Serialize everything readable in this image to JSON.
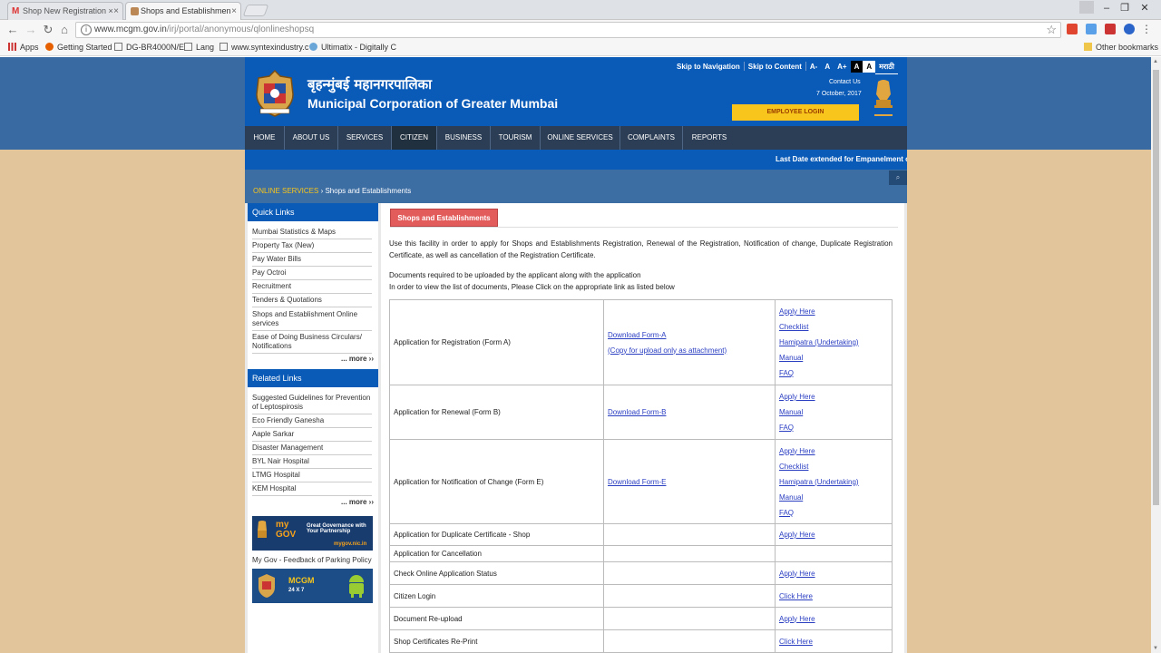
{
  "browser": {
    "tabs": [
      {
        "title": "Shop New Registration ×"
      },
      {
        "title": "Shops and Establishmen"
      }
    ],
    "url_host": "www.mcgm.gov.in",
    "url_path": "/irj/portal/anonymous/qlonlineshopsq",
    "bookmarks": [
      "Apps",
      "Getting Started",
      "DG-BR4000N/E",
      "Lang",
      "www.syntexindustry.c",
      "Ultimatix - Digitally C",
      "Other bookmarks"
    ]
  },
  "site": {
    "marathi_title": "बृहन्मुंबई महानगरपालिका",
    "title": "Municipal Corporation of Greater Mumbai",
    "topbar": [
      "Skip to Navigation",
      "Skip to Content",
      "A-",
      "A",
      "A+",
      "A",
      "A",
      "मराठी"
    ],
    "contact": "Contact Us",
    "date": "7 October, 2017",
    "employee_login": "EMPLOYEE LOGIN",
    "nav": [
      "HOME",
      "ABOUT US",
      "SERVICES",
      "CITIZEN",
      "BUSINESS",
      "TOURISM",
      "ONLINE SERVICES",
      "COMPLAINTS",
      "REPORTS"
    ],
    "ticker": "Last Date extended for Empanelment of A",
    "breadcrumb_parent": "ONLINE SERVICES",
    "breadcrumb_sep": "›",
    "breadcrumb_current": "Shops and Establishments"
  },
  "sidebar": {
    "quick_title": "Quick Links",
    "quick_links": [
      "Mumbai Statistics & Maps",
      "Property Tax (New)",
      "Pay Water Bills",
      "Pay Octroi",
      "Recruitment",
      "Tenders & Quotations",
      "Shops and Establishment Online services",
      "Ease of Doing Business Circulars/ Notifications"
    ],
    "more": "... more ››",
    "related_title": "Related Links",
    "related_links": [
      "Suggested Guidelines for Prevention of Leptospirosis",
      "Eco Friendly Ganesha",
      "Aaple Sarkar",
      "Disaster Management",
      "BYL Nair Hospital",
      "LTMG Hospital",
      "KEM Hospital"
    ],
    "mygov_banner": "Great Governance with Your Partnership",
    "mygov_url": "mygov.nic.in",
    "mygov_caption": "My Gov - Feedback of Parking Policy",
    "mcgm_app_title": "MCGM",
    "mcgm_app_sub": "24 X 7"
  },
  "content": {
    "heading": "Shops and Establishments",
    "intro": "Use this facility in order to apply for Shops and Establishments Registration, Renewal of the Registration, Notification of change, Duplicate Registration Certificate, as well as cancellation of the Registration Certificate.",
    "docs_line1": "Documents required to be uploaded by the applicant along with the application",
    "docs_line2": "In order to view the list of documents, Please Click on the appropriate link as listed below",
    "rows": [
      {
        "label": "Application for Registration (Form A)",
        "forms": [
          "Download Form-A",
          "(Copy for upload only as attachment)"
        ],
        "links": [
          "Apply Here",
          "Checklist",
          "Hamipatra (Undertaking)",
          "Manual",
          "FAQ"
        ]
      },
      {
        "label": "Application for Renewal (Form B)",
        "forms": [
          "Download Form-B"
        ],
        "links": [
          "Apply Here",
          "Manual",
          "FAQ"
        ]
      },
      {
        "label": "Application for Notification of Change (Form E)",
        "forms": [
          "Download Form-E"
        ],
        "links": [
          "Apply Here",
          "Checklist",
          "Hamipatra (Undertaking)",
          "Manual",
          "FAQ"
        ]
      },
      {
        "label": "Application for Duplicate Certificate - Shop",
        "forms": [],
        "links": [
          "Apply Here"
        ]
      },
      {
        "label": "Application for Cancellation",
        "forms": [],
        "links": []
      },
      {
        "label": "Check Online Application Status",
        "forms": [],
        "links": [
          "Apply Here"
        ]
      },
      {
        "label": "Citizen Login",
        "forms": [],
        "links": [
          "Click Here"
        ]
      },
      {
        "label": "Document Re-upload",
        "forms": [],
        "links": [
          "Apply Here"
        ]
      },
      {
        "label": "Shop Certificates Re-Print",
        "forms": [],
        "links": [
          "Click Here"
        ]
      }
    ]
  }
}
